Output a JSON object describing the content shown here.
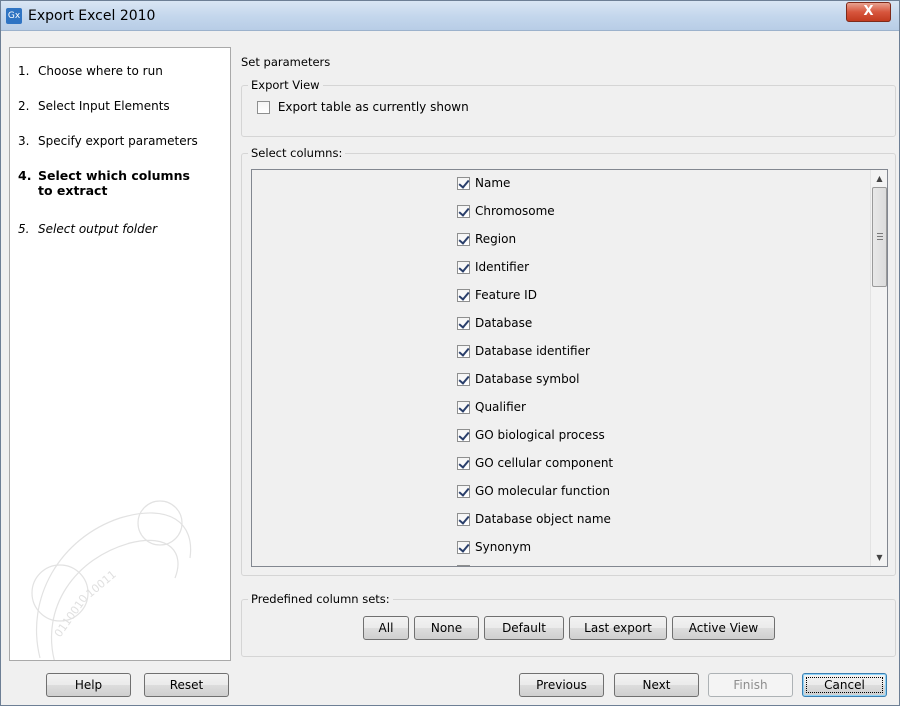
{
  "window": {
    "title": "Export Excel 2010",
    "app_icon_text": "Gx",
    "close_glyph": "X"
  },
  "steps": [
    {
      "num": "1.",
      "label": "Choose where to run",
      "state": "done"
    },
    {
      "num": "2.",
      "label": "Select Input Elements",
      "state": "done"
    },
    {
      "num": "3.",
      "label": "Specify export parameters",
      "state": "done"
    },
    {
      "num": "4.",
      "label": "Select which columns to extract",
      "state": "current"
    },
    {
      "num": "5.",
      "label": "Select output folder",
      "state": "future"
    }
  ],
  "main": {
    "section_title": "Set parameters",
    "export_view": {
      "legend": "Export View",
      "checkbox_label": "Export table as currently shown",
      "checked": false
    },
    "select_columns": {
      "legend": "Select columns:",
      "columns": [
        {
          "label": "Name",
          "checked": true
        },
        {
          "label": "Chromosome",
          "checked": true
        },
        {
          "label": "Region",
          "checked": true
        },
        {
          "label": "Identifier",
          "checked": true
        },
        {
          "label": "Feature ID",
          "checked": true
        },
        {
          "label": "Database",
          "checked": true
        },
        {
          "label": "Database identifier",
          "checked": true
        },
        {
          "label": "Database symbol",
          "checked": true
        },
        {
          "label": "Qualifier",
          "checked": true
        },
        {
          "label": "GO biological process",
          "checked": true
        },
        {
          "label": "GO cellular component",
          "checked": true
        },
        {
          "label": "GO molecular function",
          "checked": true
        },
        {
          "label": "Database object name",
          "checked": true
        },
        {
          "label": "Synonym",
          "checked": true
        }
      ]
    },
    "predefined": {
      "legend": "Predefined column sets:",
      "buttons": [
        "All",
        "None",
        "Default",
        "Last export",
        "Active View"
      ]
    }
  },
  "footer": {
    "help": "Help",
    "reset": "Reset",
    "previous": "Previous",
    "next": "Next",
    "finish": "Finish",
    "cancel": "Cancel"
  },
  "colors": {
    "titlebar": "#c3d6ec",
    "close_button": "#d7563d",
    "checkbox_mark": "#2a3f6b"
  }
}
